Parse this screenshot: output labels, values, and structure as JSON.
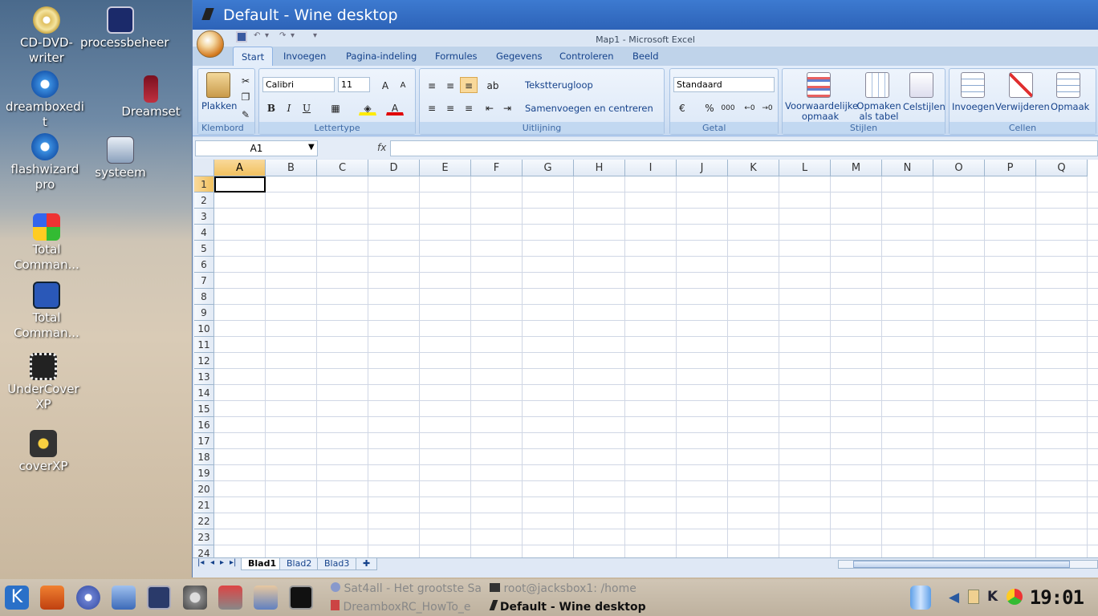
{
  "desktop": {
    "icons": [
      {
        "label": "CD-DVD-writer"
      },
      {
        "label": "processbeheer"
      },
      {
        "label": "Dreamset"
      },
      {
        "label": "dreamboxedit"
      },
      {
        "label": "flashwizard pro"
      },
      {
        "label": "systeem"
      },
      {
        "label": "Total Comman..."
      },
      {
        "label": "Total Comman..."
      },
      {
        "label": "UnderCover XP"
      },
      {
        "label": "coverXP"
      }
    ]
  },
  "window": {
    "title": "Default - Wine desktop",
    "app_title": "Map1 - Microsoft Excel"
  },
  "ribbon": {
    "tabs": [
      "Start",
      "Invoegen",
      "Pagina-indeling",
      "Formules",
      "Gegevens",
      "Controleren",
      "Beeld"
    ],
    "active_tab": "Start",
    "groups": {
      "klembord": {
        "label": "Klembord",
        "paste": "Plakken"
      },
      "lettertype": {
        "label": "Lettertype",
        "font": "Calibri",
        "size": "11",
        "bold": "B",
        "italic": "I",
        "underline": "U"
      },
      "uitlijning": {
        "label": "Uitlijning",
        "wrap": "Tekstterugloop",
        "merge": "Samenvoegen en centreren"
      },
      "getal": {
        "label": "Getal",
        "format": "Standaard",
        "percent": "%",
        "thousands": "000"
      },
      "stijlen": {
        "label": "Stijlen",
        "conditional": "Voorwaardelijke opmaak",
        "as_table": "Opmaken als tabel",
        "cell_styles": "Celstijlen"
      },
      "cellen": {
        "label": "Cellen",
        "insert": "Invoegen",
        "delete": "Verwijderen",
        "format": "Opmaak"
      }
    }
  },
  "formula_bar": {
    "name_box": "A1",
    "fx": "fx",
    "value": ""
  },
  "grid": {
    "columns": [
      "A",
      "B",
      "C",
      "D",
      "E",
      "F",
      "G",
      "H",
      "I",
      "J",
      "K",
      "L",
      "M",
      "N",
      "O",
      "P",
      "Q"
    ],
    "rows": [
      "1",
      "2",
      "3",
      "4",
      "5",
      "6",
      "7",
      "8",
      "9",
      "10",
      "11",
      "12",
      "13",
      "14",
      "15",
      "16",
      "17",
      "18",
      "19",
      "20",
      "21",
      "22",
      "23",
      "24"
    ],
    "active_cell": "A1"
  },
  "sheets": [
    "Blad1",
    "Blad2",
    "Blad3"
  ],
  "active_sheet": "Blad1",
  "taskbar": {
    "tasks": [
      "Sat4all - Het grootste Sa",
      "root@jacksbox1: /home",
      "DreamboxRC_HowTo_e",
      "Default - Wine desktop"
    ],
    "clock": "19:01"
  }
}
